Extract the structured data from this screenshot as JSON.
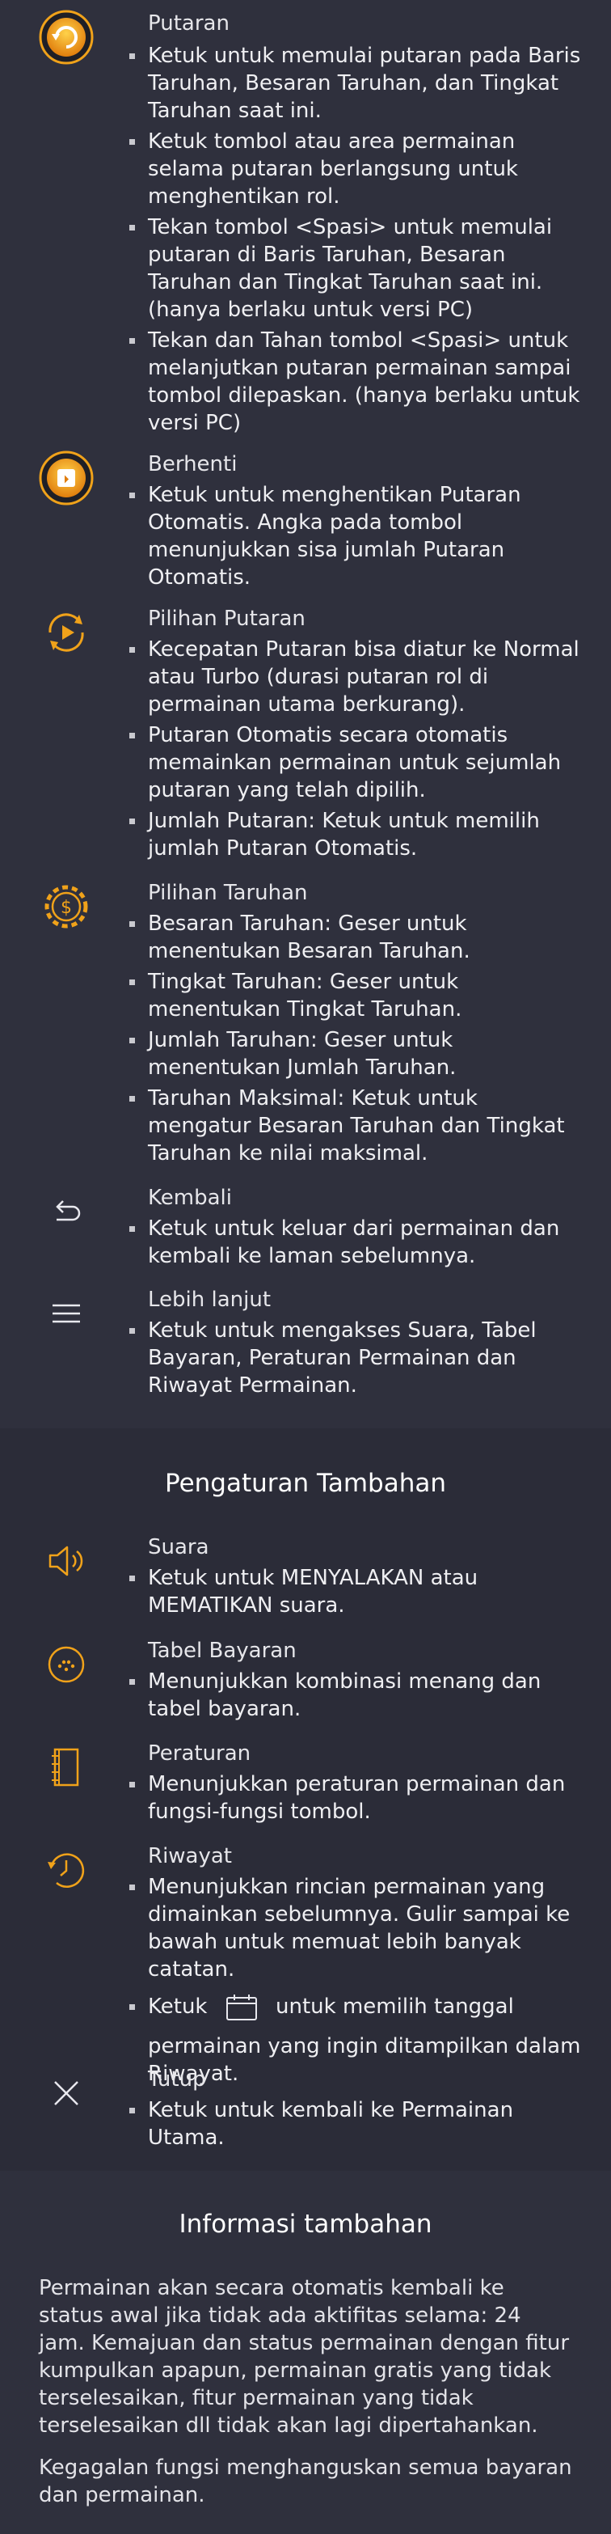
{
  "spin": {
    "title": "Putaran",
    "bullets": [
      "Ketuk untuk memulai putaran pada Baris Taruhan, Besaran Taruhan, dan Tingkat Taruhan saat ini.",
      "Ketuk tombol atau area permainan selama putaran berlangsung untuk menghentikan rol.",
      "Tekan tombol <Spasi> untuk memulai putaran di Baris Taruhan, Besaran Taruhan dan Tingkat Taruhan saat ini. (hanya berlaku untuk versi PC)",
      "Tekan dan Tahan tombol <Spasi> untuk melanjutkan putaran permainan sampai tombol dilepaskan. (hanya berlaku untuk versi PC)"
    ]
  },
  "stop": {
    "title": "Berhenti",
    "bullets": [
      "Ketuk untuk menghentikan Putaran Otomatis. Angka pada tombol menunjukkan sisa jumlah Putaran Otomatis."
    ]
  },
  "spin_options": {
    "title": "Pilihan Putaran",
    "bullets": [
      "Kecepatan Putaran bisa diatur ke Normal atau Turbo (durasi putaran rol di permainan utama berkurang).",
      "Putaran Otomatis secara otomatis memainkan permainan untuk sejumlah putaran yang telah dipilih.",
      "Jumlah Putaran: Ketuk untuk memilih jumlah Putaran Otomatis."
    ]
  },
  "bet_options": {
    "title": "Pilihan Taruhan",
    "bullets": [
      "Besaran Taruhan: Geser untuk menentukan Besaran Taruhan.",
      "Tingkat Taruhan: Geser untuk menentukan Tingkat Taruhan.",
      "Jumlah Taruhan: Geser untuk menentukan Jumlah Taruhan.",
      "Taruhan Maksimal: Ketuk untuk mengatur Besaran Taruhan dan Tingkat Taruhan ke nilai maksimal."
    ]
  },
  "back": {
    "title": "Kembali",
    "bullets": [
      "Ketuk untuk keluar dari permainan dan kembali ke laman sebelumnya."
    ]
  },
  "more": {
    "title": "Lebih lanjut",
    "bullets": [
      "Ketuk untuk mengakses Suara, Tabel Bayaran, Peraturan Permainan dan Riwayat Permainan."
    ]
  },
  "extra_settings": {
    "heading": "Pengaturan Tambahan",
    "sound": {
      "title": "Suara",
      "bullets": [
        "Ketuk untuk MENYALAKAN atau MEMATIKAN suara."
      ]
    },
    "paytable": {
      "title": "Tabel Bayaran",
      "bullets": [
        "Menunjukkan kombinasi menang dan tabel bayaran."
      ]
    },
    "rules": {
      "title": "Peraturan",
      "bullets": [
        "Menunjukkan peraturan permainan dan fungsi-fungsi tombol."
      ]
    },
    "history": {
      "title": "Riwayat",
      "bullets": [
        "Menunjukkan rincian permainan yang dimainkan sebelumnya. Gulir sampai ke bawah untuk memuat lebih banyak catatan."
      ],
      "calendar_prefix": "Ketuk",
      "calendar_suffix": "untuk memilih tanggal",
      "calendar_rest": "permainan yang ingin ditampilkan dalam Riwayat."
    },
    "close": {
      "title": "Tutup",
      "bullets": [
        "Ketuk untuk kembali ke Permainan Utama."
      ]
    }
  },
  "extra_info": {
    "heading": "Informasi tambahan",
    "paragraphs": [
      "Permainan akan secara otomatis kembali ke status awal jika tidak ada aktifitas selama: 24 jam. Kemajuan dan status permainan dengan fitur kumpulkan apapun, permainan gratis yang tidak terselesaikan, fitur permainan yang tidak terselesaikan dll tidak akan lagi dipertahankan.",
      "Kegagalan fungsi menghanguskan semua bayaran dan permainan."
    ]
  },
  "colors": {
    "accent": "#f0a21a",
    "icon_line": "#e8e8ee",
    "text": "#efeff2"
  }
}
